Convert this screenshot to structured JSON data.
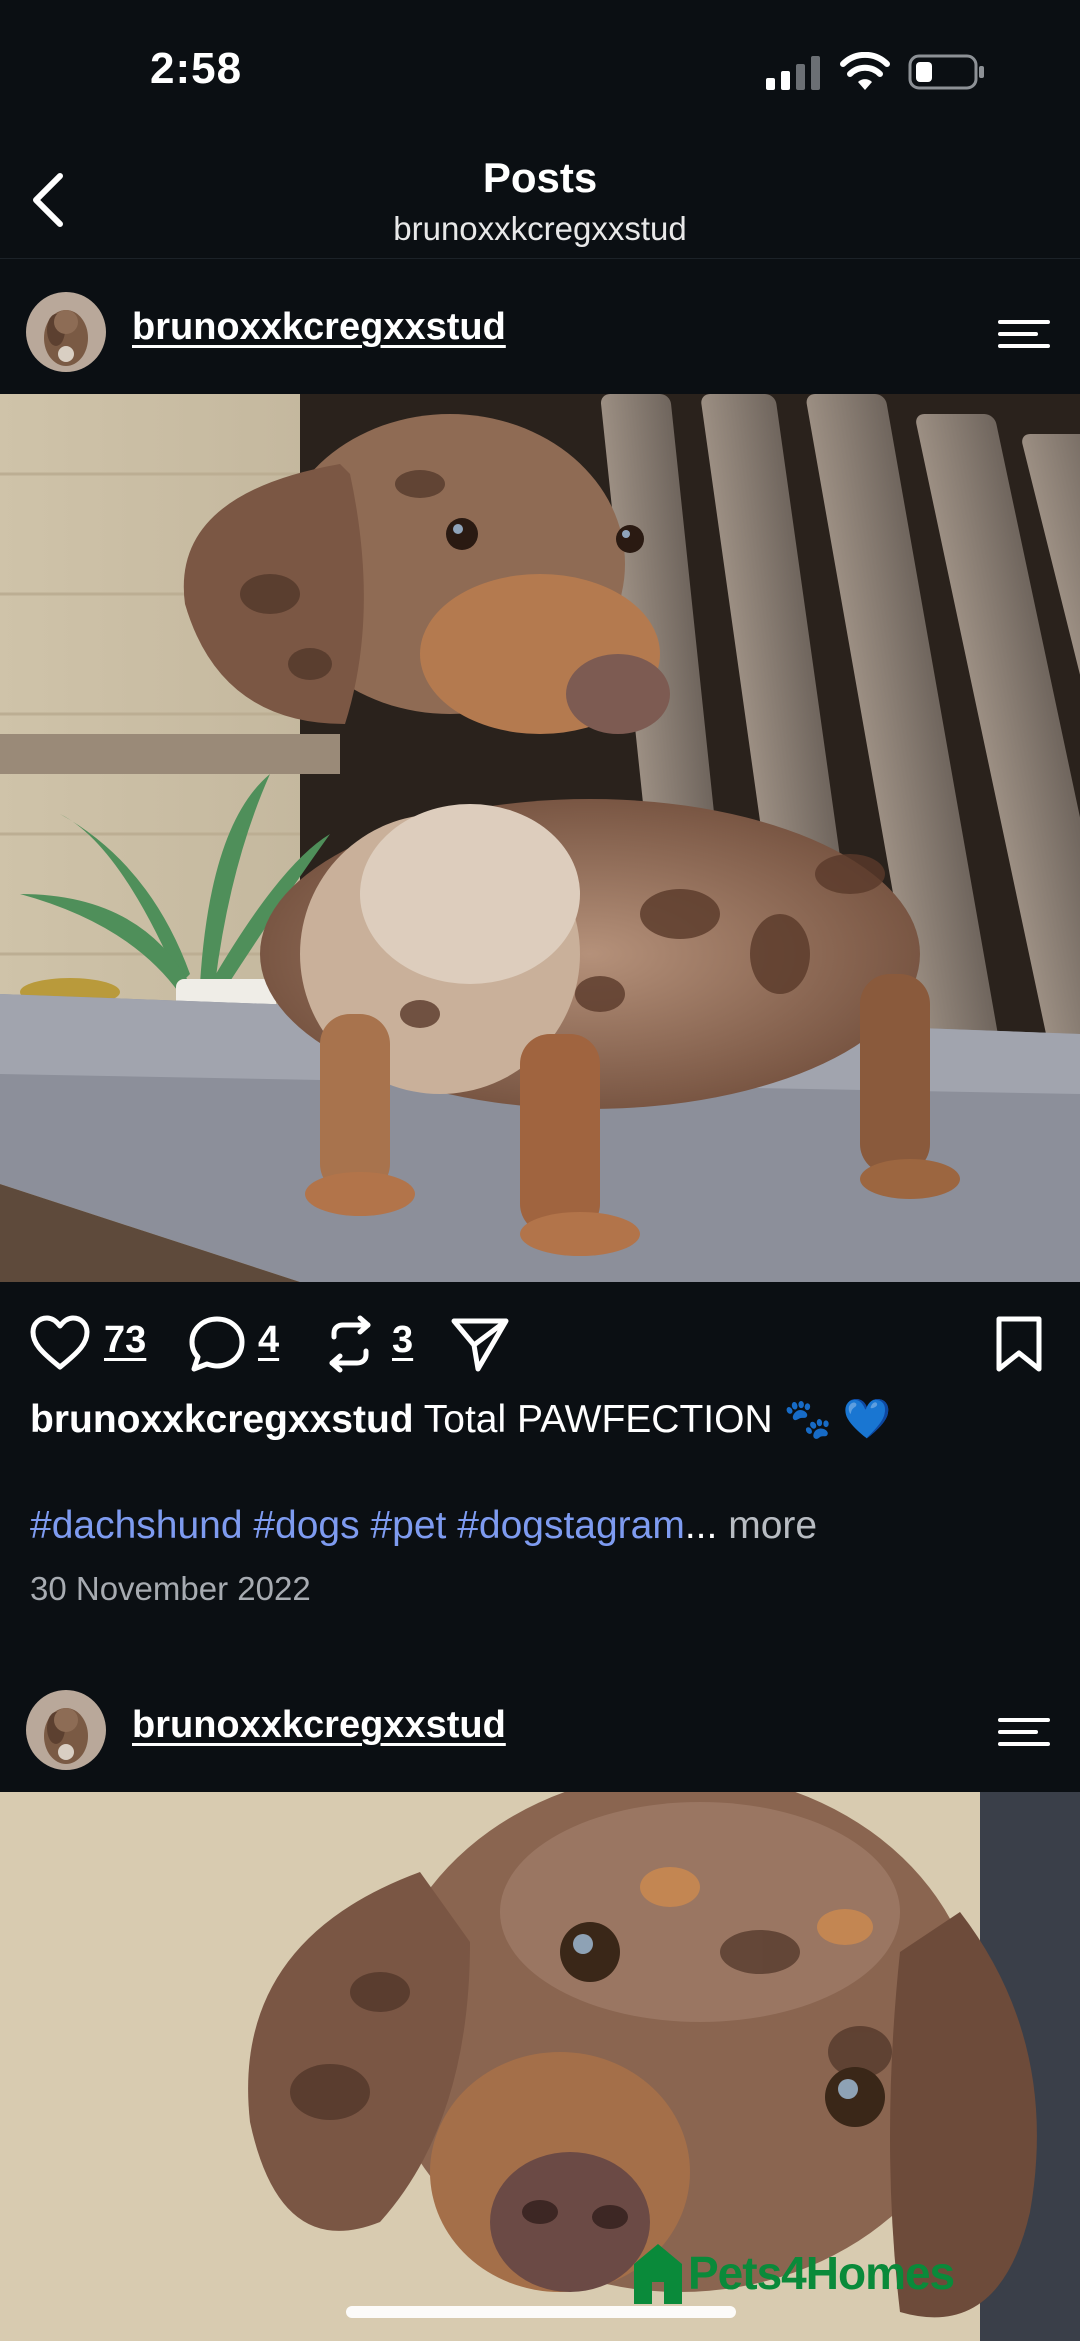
{
  "status_bar": {
    "time": "2:58"
  },
  "header": {
    "title": "Posts",
    "subtitle": "brunoxxkcregxxstud"
  },
  "posts": [
    {
      "username": "brunoxxkcregxxstud",
      "likes": "73",
      "comments": "4",
      "reposts": "3",
      "caption_user": "brunoxxkcregxxstud",
      "caption_text": "Total PAWFECTION",
      "caption_emoji": "🐾 💙",
      "hashtags": "#dachshund #dogs #pet #dogstagram",
      "ellipsis": "...",
      "more_label": "more",
      "date": "30 November 2022"
    },
    {
      "username": "brunoxxkcregxxstud"
    }
  ],
  "watermark": "Pets4Homes",
  "icons": {
    "back": "chevron-left-icon",
    "menu": "menu-icon",
    "like": "heart-icon",
    "comment": "comment-icon",
    "repost": "repost-icon",
    "share": "send-icon",
    "bookmark": "bookmark-icon"
  },
  "colors": {
    "background": "#0b0f13",
    "hashtag": "#7e9bf0",
    "date": "#a7abb1",
    "watermark": "#0a8a3a"
  }
}
